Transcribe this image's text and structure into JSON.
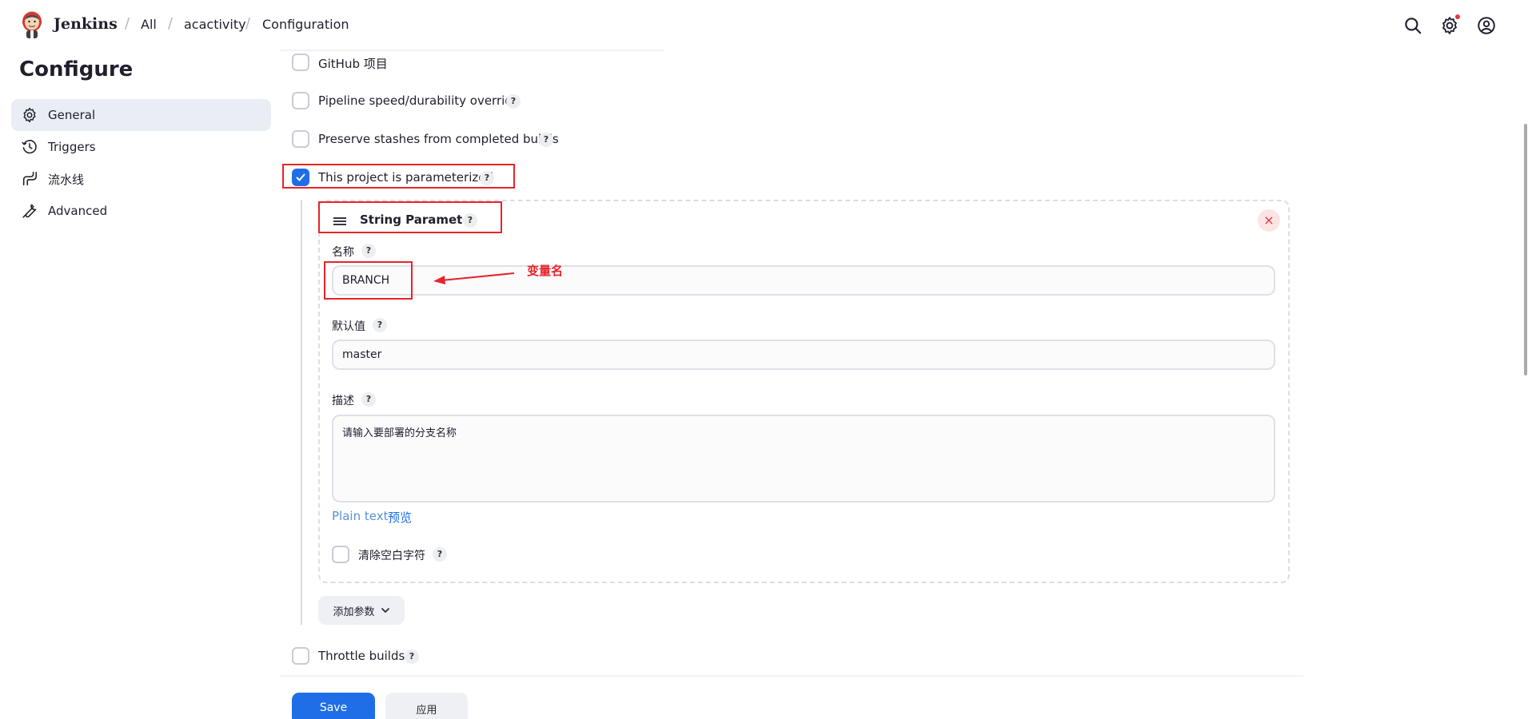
{
  "header": {
    "brand": "Jenkins",
    "breadcrumbs": [
      "All",
      "acactivity",
      "Configuration"
    ],
    "icons": [
      "search-icon",
      "gear-icon",
      "user-icon"
    ]
  },
  "sidebar": {
    "title": "Configure",
    "items": [
      {
        "label": "General",
        "icon": "gear-icon",
        "active": true
      },
      {
        "label": "Triggers",
        "icon": "clock-icon",
        "active": false
      },
      {
        "label": "流水线",
        "icon": "pipeline-icon",
        "active": false
      },
      {
        "label": "Advanced",
        "icon": "wrench-icon",
        "active": false
      }
    ]
  },
  "options": {
    "github_project": "GitHub 项目",
    "pipeline_speed": "Pipeline speed/durability override",
    "preserve_stashes": "Preserve stashes from completed builds",
    "parameterized": "This project is parameterized",
    "throttle_builds": "Throttle builds"
  },
  "help_mark": "?",
  "param": {
    "title": "String Parameter",
    "name_label": "名称",
    "name_value": "BRANCH",
    "default_label": "默认值",
    "default_value": "master",
    "desc_label": "描述",
    "desc_value": "请输入要部署的分支名称",
    "plain_text": "Plain text",
    "preview": "预览",
    "trim_label": "清除空白字符",
    "close": "×"
  },
  "annotation": "变量名",
  "add_param": "添加参数",
  "buttons": {
    "save": "Save",
    "apply": "应用"
  },
  "colors": {
    "accent": "#1f6ee8",
    "annotation": "#e8232a"
  }
}
